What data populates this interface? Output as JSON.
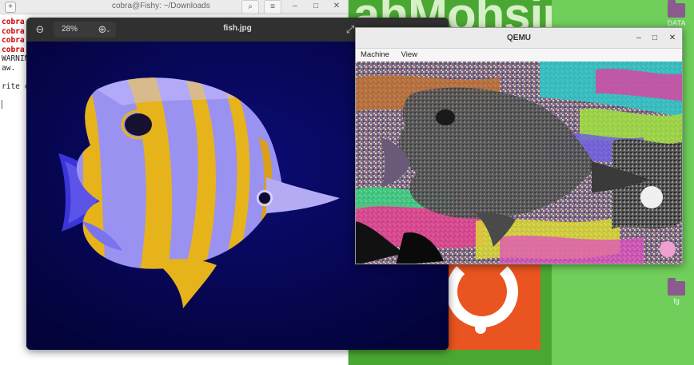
{
  "wallpaper": {
    "logo_text": "ahMohsin"
  },
  "desktop_icons": [
    {
      "label": "DATA"
    },
    {
      "label": "fg"
    }
  ],
  "terminal": {
    "title": "cobra@Fishy: ~/Downloads",
    "lines": [
      "cobra",
      "cobra",
      "cobra",
      "cobra",
      "WARNIN",
      "aw.",
      "",
      "rite c"
    ]
  },
  "viewer": {
    "zoom": "28%",
    "filename": "fish.jpg"
  },
  "qemu": {
    "title": "QEMU",
    "menu": [
      "Machine",
      "View"
    ]
  },
  "colors": {
    "wallpaper_green": "#4aa832",
    "ubuntu_orange": "#e95420",
    "fish_yellow": "#e6b31a",
    "fish_lavender": "#9a92f0",
    "viewer_bg": "#050540"
  }
}
